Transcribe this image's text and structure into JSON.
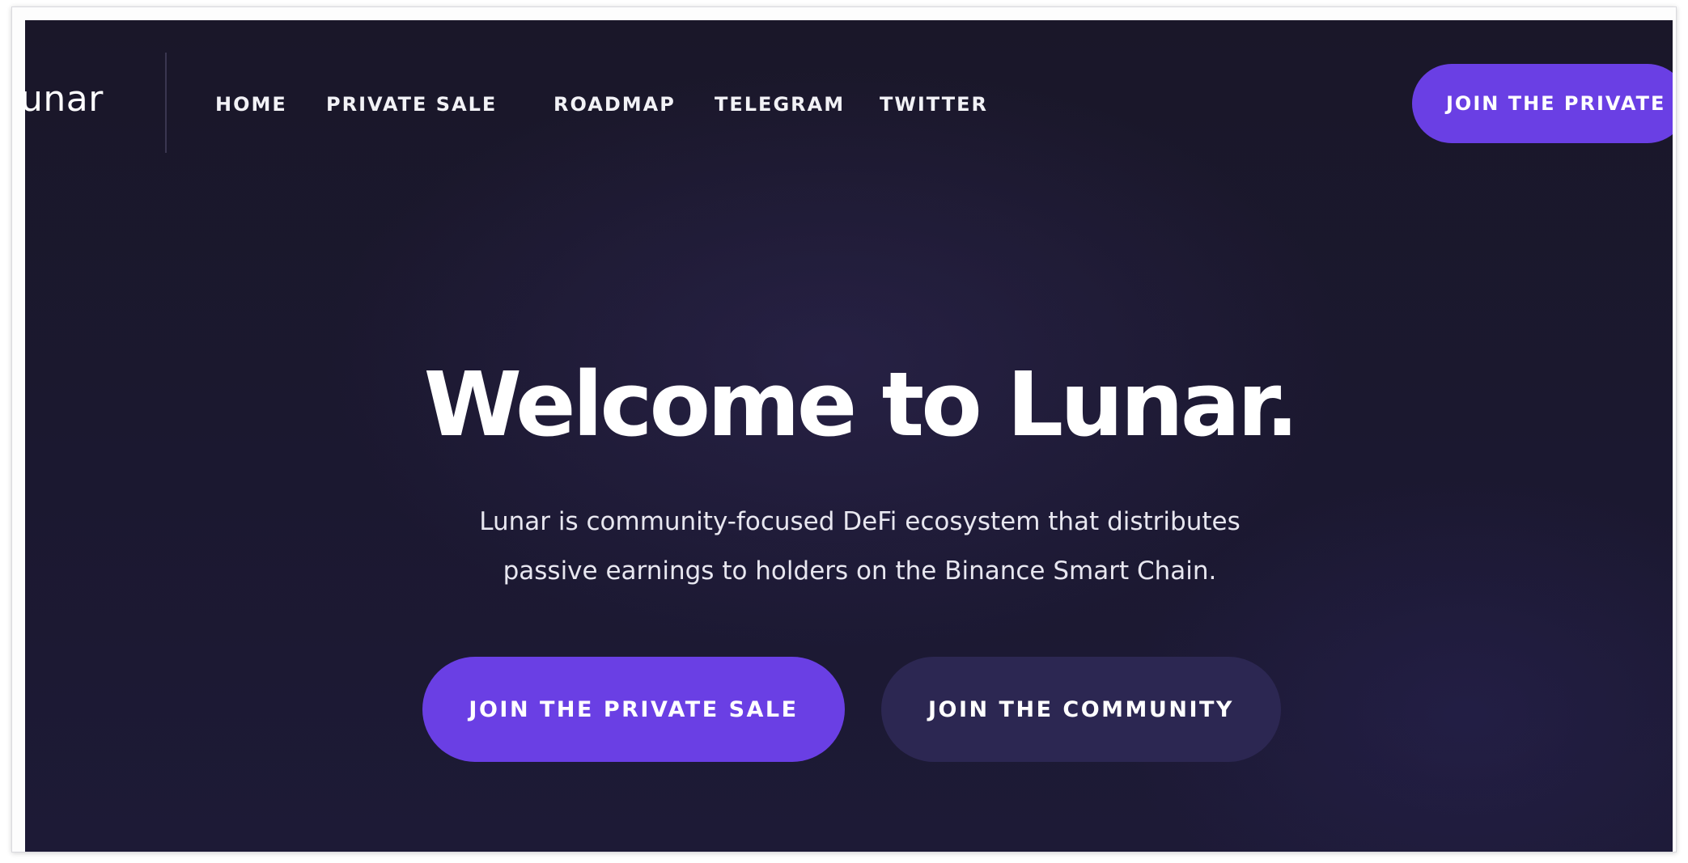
{
  "header": {
    "logo_text": "unar",
    "nav": [
      {
        "label": "HOME"
      },
      {
        "label": "PRIVATE SALE"
      },
      {
        "label": "ROADMAP"
      },
      {
        "label": "TELEGRAM"
      },
      {
        "label": "TWITTER"
      }
    ],
    "cta_label": "JOIN THE PRIVATE"
  },
  "hero": {
    "title": "Welcome to Lunar.",
    "description_line1": "Lunar is community-focused DeFi ecosystem that distributes",
    "description_line2": "passive earnings to holders on the Binance Smart Chain.",
    "primary_button": "JOIN THE PRIVATE SALE",
    "secondary_button": "JOIN THE COMMUNITY"
  },
  "colors": {
    "background": "#1a1729",
    "accent": "#6a3fe4",
    "secondary_button": "#2c2752",
    "text": "#ffffff"
  }
}
